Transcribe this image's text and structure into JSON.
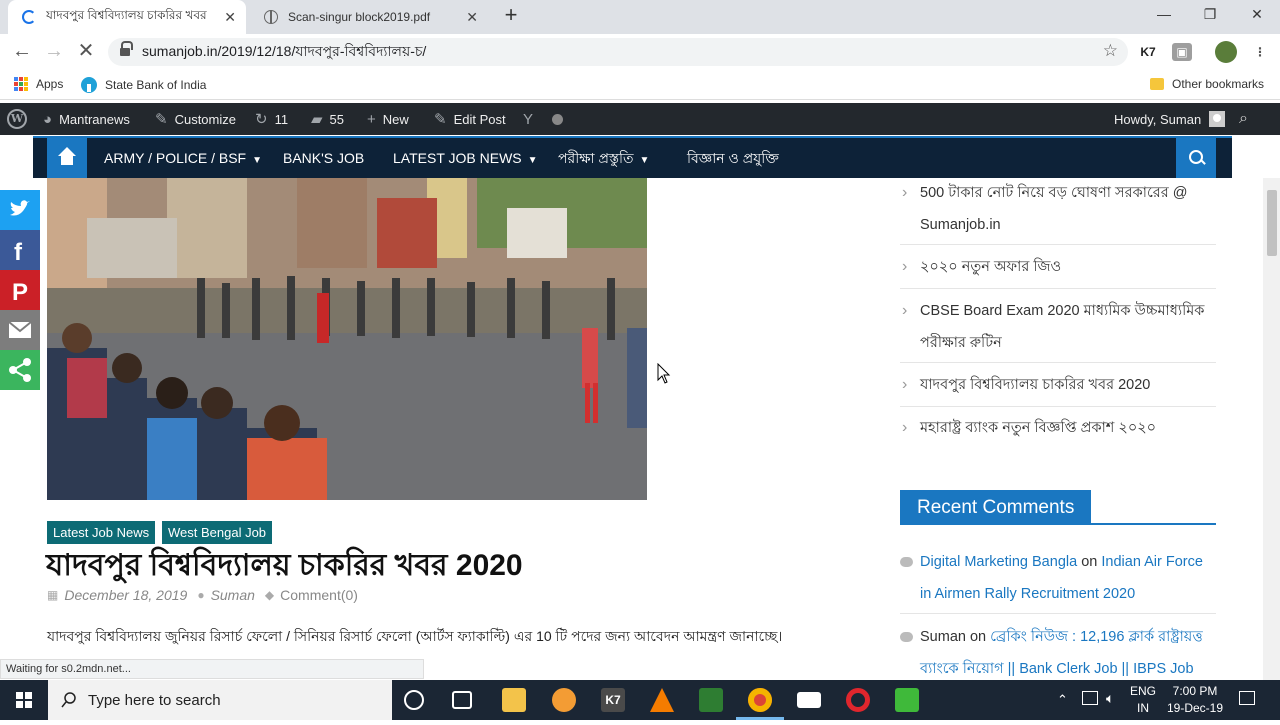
{
  "browser": {
    "tabs": [
      {
        "title": "যাদবপুর বিশ্ববিদ্যালয় চাকরির খবর"
      },
      {
        "title": "Scan-singur block2019.pdf"
      }
    ],
    "url": "sumanjob.in/2019/12/18/যাদবপুর-বিশ্ববিদ্যালয়-চ/",
    "bookmarks": [
      "Apps",
      "State Bank of India"
    ],
    "other_bookmarks": "Other bookmarks",
    "status": "Waiting for s0.2mdn.net...",
    "ext_k7": "K7"
  },
  "adminbar": {
    "site": "Mantranews",
    "customize": "Customize",
    "updates": "11",
    "comments": "55",
    "new": "New",
    "edit": "Edit Post",
    "howdy": "Howdy, Suman"
  },
  "nav": {
    "items": [
      "ARMY / POLICE / BSF",
      "BANK'S JOB",
      "LATEST JOB NEWS",
      "পরীক্ষা প্রস্তুতি",
      "বিজ্ঞান ও প্রযুক্তি"
    ]
  },
  "article": {
    "categories": [
      "Latest Job News",
      "West Bengal Job"
    ],
    "title": "যাদবপুর বিশ্ববিদ্যালয় চাকরির খবর 2020",
    "date": "December 18, 2019",
    "author": "Suman",
    "comments": "Comment(0)",
    "excerpt": "যাদবপুর বিশ্ববিদ্যালয় জুনিয়র রিসার্চ ফেলো / সিনিয়র রিসার্চ ফেলো (আর্টস ফ্যাকাল্টি) এর 10 টি পদের জন্য আবেদন আমন্ত্রণ জানাচ্ছে।"
  },
  "sidebar": {
    "recent_posts": [
      "500 টাকার নোট নিয়ে বড় ঘোষণা সরকারের @ Sumanjob.in",
      "২০২০ নতুন অফার জিও",
      "CBSE Board Exam 2020 মাধ্যমিক উচ্চমাধ্যমিক পরীক্ষার রুটিন",
      "যাদবপুর বিশ্ববিদ্যালয় চাকরির খবর 2020",
      "মহারাষ্ট্র ব্যাংক নতুন বিজ্ঞপ্তি প্রকাশ ২০২০"
    ],
    "recent_comments_title": "Recent Comments",
    "comments": [
      {
        "author": "Digital Marketing Bangla",
        "on": "on",
        "post": "Indian Air Force in Airmen Rally Recruitment 2020"
      },
      {
        "author": "Suman",
        "on": "on",
        "post": "ব্রেকিং নিউজ : 12,196 ক্লার্ক রাষ্ট্রায়ত্ত ব্যাংকে নিয়োগ || Bank Clerk Job || IBPS Job"
      }
    ]
  },
  "taskbar": {
    "search_placeholder": "Type here to search",
    "lang1": "ENG",
    "lang2": "IN",
    "time": "7:00 PM",
    "date": "19-Dec-19"
  }
}
